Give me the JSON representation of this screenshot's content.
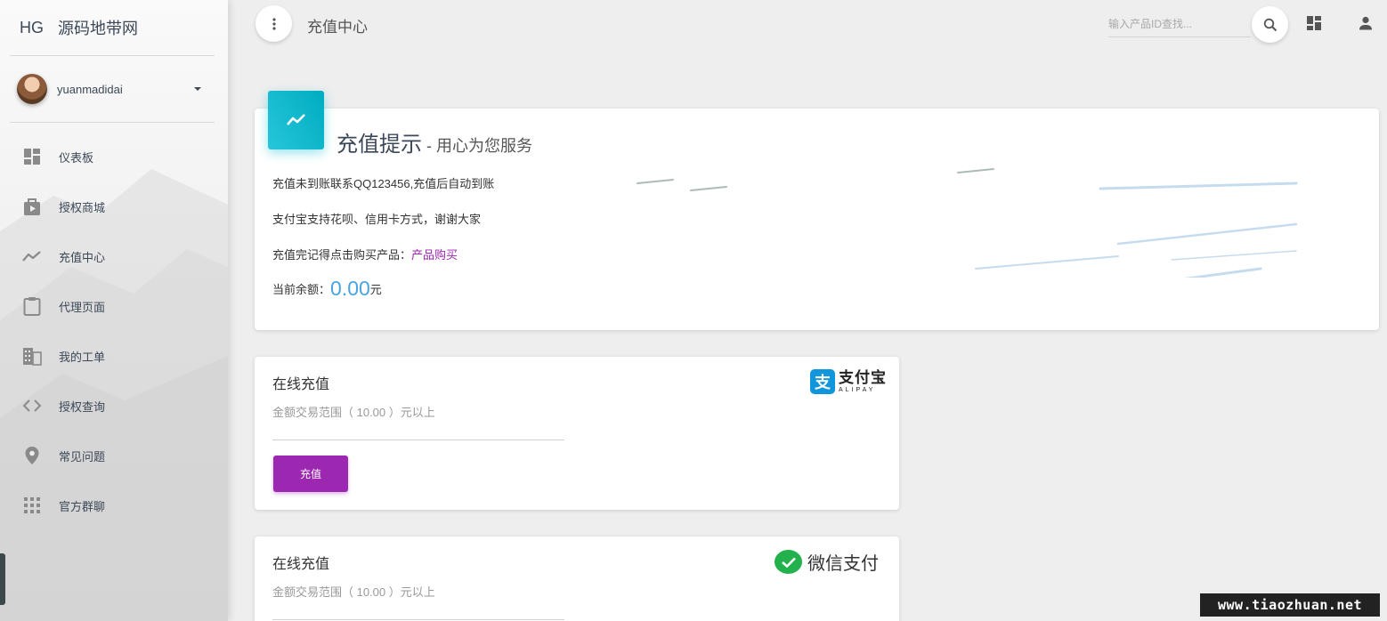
{
  "brand": {
    "mini": "HG",
    "name": "源码地带网"
  },
  "user": {
    "name": "yuanmadidai"
  },
  "sidebar": {
    "items": [
      {
        "label": "仪表板",
        "icon": "dashboard-icon"
      },
      {
        "label": "授权商城",
        "icon": "shopping-bag-icon"
      },
      {
        "label": "充值中心",
        "icon": "trending-icon"
      },
      {
        "label": "代理页面",
        "icon": "clipboard-icon"
      },
      {
        "label": "我的工单",
        "icon": "building-icon"
      },
      {
        "label": "授权查询",
        "icon": "code-icon"
      },
      {
        "label": "常见问题",
        "icon": "location-pin-icon"
      },
      {
        "label": "官方群聊",
        "icon": "apps-grid-icon"
      }
    ]
  },
  "topbar": {
    "title": "充值中心",
    "search_placeholder": "输入产品ID查找..."
  },
  "notice": {
    "title": "充值提示",
    "subtitle": " - 用心为您服务",
    "line1": "充值未到账联系QQ123456,充值后自动到账",
    "line2": "支付宝支持花呗、信用卡方式，谢谢大家",
    "line3_prefix": "充值完记得点击购买产品：",
    "line3_link": "产品购买",
    "balance_label": "当前余额：",
    "balance_value": "0.00",
    "balance_unit": "元"
  },
  "alipay_card": {
    "title": "在线充值",
    "range": "金额交易范围（  10.00  ）元以上",
    "button": "充值",
    "logo_cn": "支付宝",
    "logo_en": "ALIPAY"
  },
  "wechat_card": {
    "title": "在线充值",
    "range": "金额交易范围（  10.00  ）元以上",
    "logo_text": "微信支付"
  },
  "watermark": "www.tiaozhuan.net",
  "colors": {
    "accent_purple": "#9c27b0",
    "icon_cyan": "#00acc1",
    "balance_blue": "#4aa3df",
    "wechat_green": "#22b14c",
    "alipay_blue": "#1296db"
  }
}
